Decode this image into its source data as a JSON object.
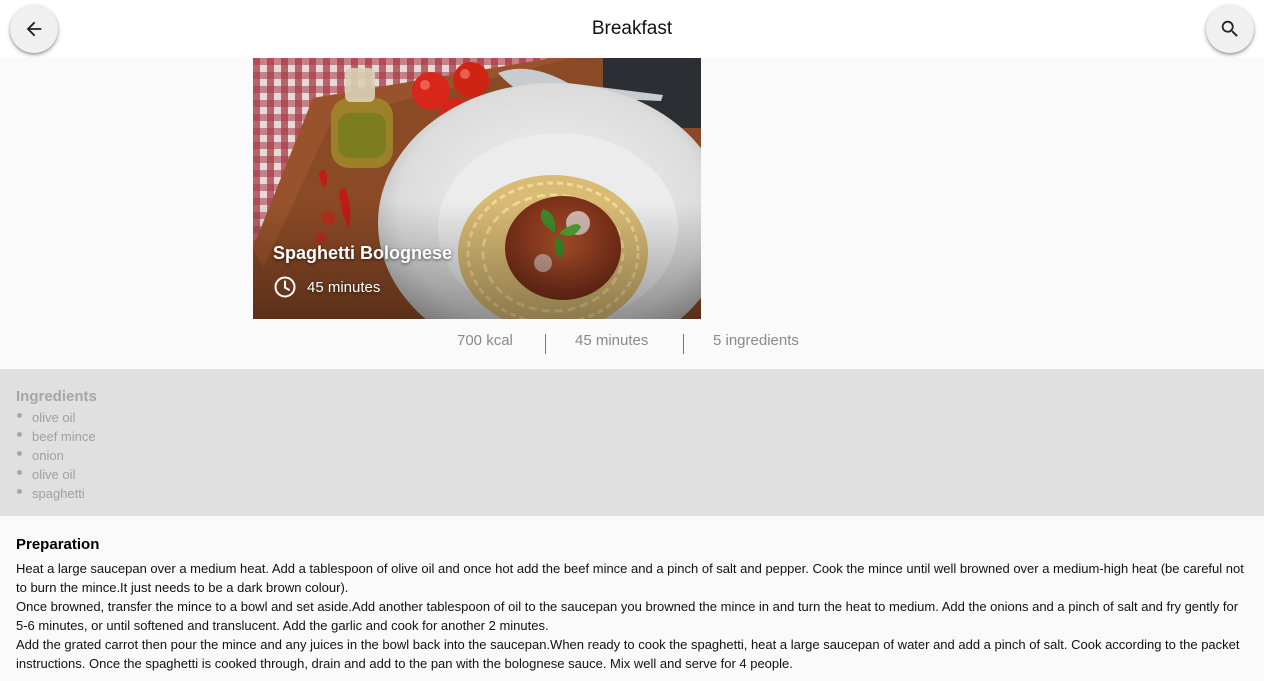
{
  "header": {
    "title": "Breakfast",
    "back_icon": "arrow-back-icon",
    "search_icon": "search-icon"
  },
  "recipe": {
    "title": "Spaghetti Bolognese",
    "time": "45 minutes",
    "clock_icon": "clock-icon"
  },
  "stats": {
    "kcal": "700 kcal",
    "duration": "45 minutes",
    "ingredients_count": "5 ingredients"
  },
  "ingredients": {
    "title": "Ingredients",
    "items": [
      "olive oil",
      "beef mince",
      "onion",
      "olive oil",
      "spaghetti"
    ]
  },
  "preparation": {
    "title": "Preparation",
    "paragraphs": [
      "Heat a large saucepan over a medium heat. Add a tablespoon of olive oil and once hot add the beef mince and a pinch of salt and pepper. Cook the mince until well browned over a medium-high heat (be careful not to burn the mince.It just needs to be a dark brown colour).",
      "Once browned, transfer the mince to a bowl and set aside.Add another tablespoon of oil to the saucepan you browned the mince in and turn the heat to medium. Add the onions and a pinch of salt and fry gently for 5-6 minutes, or until softened and translucent. Add the garlic and cook for another 2 minutes.",
      "Add the grated carrot then pour the mince and any juices in the bowl back into the saucepan.When ready to cook the spaghetti, heat a large saucepan of water and add a pinch of salt. Cook according to the packet instructions. Once the spaghetti is cooked through, drain and add to the pan with the bolognese sauce. Mix well and serve for 4 people."
    ]
  },
  "colors": {
    "header_bg": "#ffffff",
    "page_bg": "#fafafa",
    "ingredients_bg": "#e0e0e0",
    "muted_text": "#8a8a8a"
  }
}
